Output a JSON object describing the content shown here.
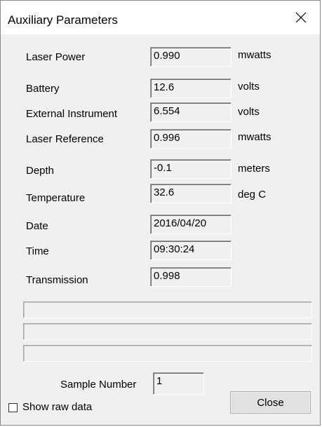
{
  "window": {
    "title": "Auxiliary Parameters"
  },
  "parameters": [
    {
      "label": "Laser Power",
      "value": "0.990",
      "unit": "mwatts"
    },
    {
      "label": "Battery",
      "value": "12.6",
      "unit": "volts"
    },
    {
      "label": "External Instrument",
      "value": "6.554",
      "unit": "volts"
    },
    {
      "label": "Laser Reference",
      "value": "0.996",
      "unit": "mwatts"
    },
    {
      "label": "Depth",
      "value": "-0.1",
      "unit": "meters"
    },
    {
      "label": "Temperature",
      "value": "32.6",
      "unit": "deg C"
    },
    {
      "label": "Date",
      "value": "2016/04/20",
      "unit": ""
    },
    {
      "label": "Time",
      "value": "09:30:24",
      "unit": ""
    },
    {
      "label": "Transmission",
      "value": "0.998",
      "unit": ""
    }
  ],
  "sample": {
    "label": "Sample Number",
    "value": "1"
  },
  "options": {
    "show_raw_data_label": "Show raw data",
    "show_raw_data_checked": false
  },
  "buttons": {
    "close_label": "Close"
  },
  "icons": {
    "close": "close-x-icon"
  }
}
